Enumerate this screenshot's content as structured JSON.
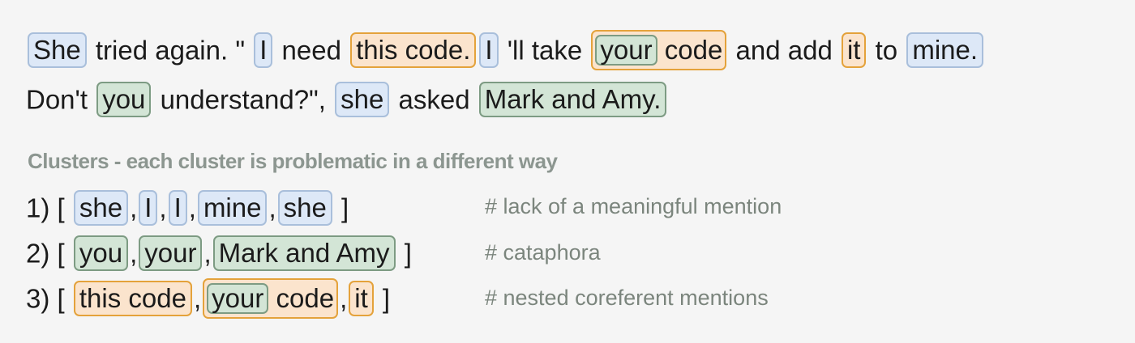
{
  "sentence": {
    "line1": [
      {
        "text": "She",
        "color": "blue"
      },
      {
        "text": "tried again. \""
      },
      {
        "text": "I",
        "color": "blue"
      },
      {
        "text": "need"
      },
      {
        "text": "this code.",
        "color": "orange"
      },
      {
        "text": "I",
        "color": "blue"
      },
      {
        "text": "'ll take"
      },
      {
        "text": "your",
        "color": "green",
        "outer": "orange",
        "outer_text": "code"
      },
      {
        "text": "and add"
      },
      {
        "text": "it",
        "color": "orange"
      },
      {
        "text": "to"
      },
      {
        "text": "mine.",
        "color": "blue"
      }
    ],
    "line2": [
      {
        "text": "Don't"
      },
      {
        "text": "you",
        "color": "green"
      },
      {
        "text": "understand?\","
      },
      {
        "text": "she",
        "color": "blue"
      },
      {
        "text": "asked"
      },
      {
        "text": "Mark and Amy.",
        "color": "green"
      }
    ]
  },
  "clusters_heading": "Clusters - each cluster is problematic in a different way",
  "clusters": [
    {
      "label": "1) [",
      "close": "]",
      "mentions": [
        {
          "text": "she",
          "color": "blue"
        },
        {
          "text": "I",
          "color": "blue"
        },
        {
          "text": "I",
          "color": "blue"
        },
        {
          "text": "mine",
          "color": "blue"
        },
        {
          "text": "she",
          "color": "blue"
        }
      ],
      "comment": "# lack of a meaningful mention"
    },
    {
      "label": "2) [",
      "close": "]",
      "mentions": [
        {
          "text": "you",
          "color": "green"
        },
        {
          "text": "your",
          "color": "green"
        },
        {
          "text": "Mark and Amy",
          "color": "green"
        }
      ],
      "comment": "# cataphora"
    },
    {
      "label": "3) [",
      "close": "]",
      "mentions": [
        {
          "text": "this code",
          "color": "orange"
        },
        {
          "text": "your",
          "color": "green",
          "outer": "orange",
          "outer_text": "code"
        },
        {
          "text": "it",
          "color": "orange"
        }
      ],
      "comment": "# nested coreferent mentions"
    }
  ],
  "colors": {
    "blue": "#dde8f7",
    "green": "#d3e5d6",
    "orange": "#fbe4cd"
  }
}
